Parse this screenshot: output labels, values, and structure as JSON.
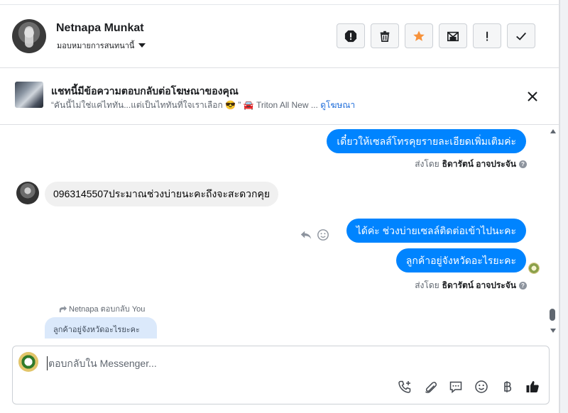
{
  "header": {
    "contact_name": "Netnapa Munkat",
    "assign_label": "มอบหมายการสนทนานี้"
  },
  "ad": {
    "title": "แชทนี้มีข้อความตอบกลับต่อโฆษณาของคุณ",
    "snippet": "“คันนี้ไม่ใช่แค่ไททัน...แต่เป็นไททันที่ใจเราเลือก 😎 ” 🚘 Triton All New ...",
    "link": "ดูโฆษณา"
  },
  "messages": {
    "m1": "เดี๋ยวให้เซลส์โทรคุยรายละเอียดเพิ่มเติมค่ะ",
    "sent_by_prefix": "ส่งโดย",
    "sent_by_name": "ธิดารัตน์ อาจประจัน",
    "m2": "0963145507ประมาณช่วงบ่ายนะคะถึงจะสะดวกคุย",
    "m3": "ได้ค่ะ ช่วงบ่ายเซลล์ติดต่อเข้าไปนะคะ",
    "m4": "ลูกค้าอยู่จังหวัดอะไรยะคะ",
    "reply_hint": "Netnapa ตอบกลับ You",
    "quoted": "ลูกค้าอยู่จังหวัดอะไรยะคะ"
  },
  "composer": {
    "placeholder": "ตอบกลับใน Messenger..."
  },
  "colors": {
    "bubble_out": "#0084ff",
    "bubble_in": "#f0f0f0",
    "link": "#216fdb",
    "star": "#f7923b"
  }
}
